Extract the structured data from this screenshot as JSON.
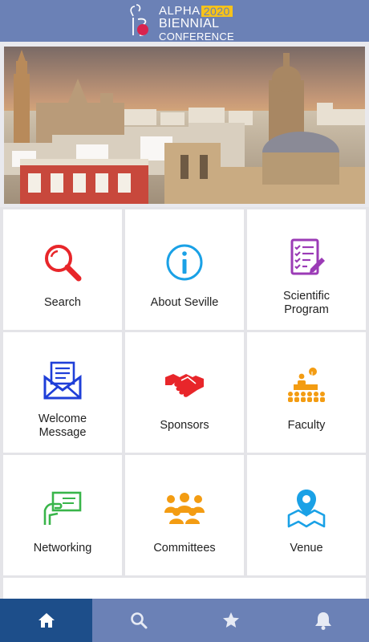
{
  "header": {
    "logo_word1": "ALPHA",
    "logo_year": "2020",
    "logo_word2": "BIENNIAL",
    "logo_word3": "CONFERENCE"
  },
  "banner": {
    "image": "seville-skyline-photo"
  },
  "menu": [
    {
      "label": "Search",
      "icon": "search-icon",
      "color": "#e8262a"
    },
    {
      "label": "About Seville",
      "icon": "info-icon",
      "color": "#1aa1e6"
    },
    {
      "label": "Scientific Program",
      "icon": "checklist-icon",
      "color": "#9b3bb6"
    },
    {
      "label": "Welcome Message",
      "icon": "envelope-icon",
      "color": "#1f3fd8"
    },
    {
      "label": "Sponsors",
      "icon": "handshake-icon",
      "color": "#e8262a"
    },
    {
      "label": "Faculty",
      "icon": "speaker-icon",
      "color": "#f39c12"
    },
    {
      "label": "Networking",
      "icon": "business-card-icon",
      "color": "#39b54a"
    },
    {
      "label": "Committees",
      "icon": "group-icon",
      "color": "#f39c12"
    },
    {
      "label": "Venue",
      "icon": "map-pin-icon",
      "color": "#1aa1e6"
    }
  ],
  "tabbar": {
    "tabs": [
      {
        "icon": "home-icon",
        "active": true
      },
      {
        "icon": "search-icon",
        "active": false
      },
      {
        "icon": "star-icon",
        "active": false
      },
      {
        "icon": "bell-icon",
        "active": false
      }
    ],
    "active_color": "#1d4e8a",
    "bar_color": "#6b81b6"
  }
}
